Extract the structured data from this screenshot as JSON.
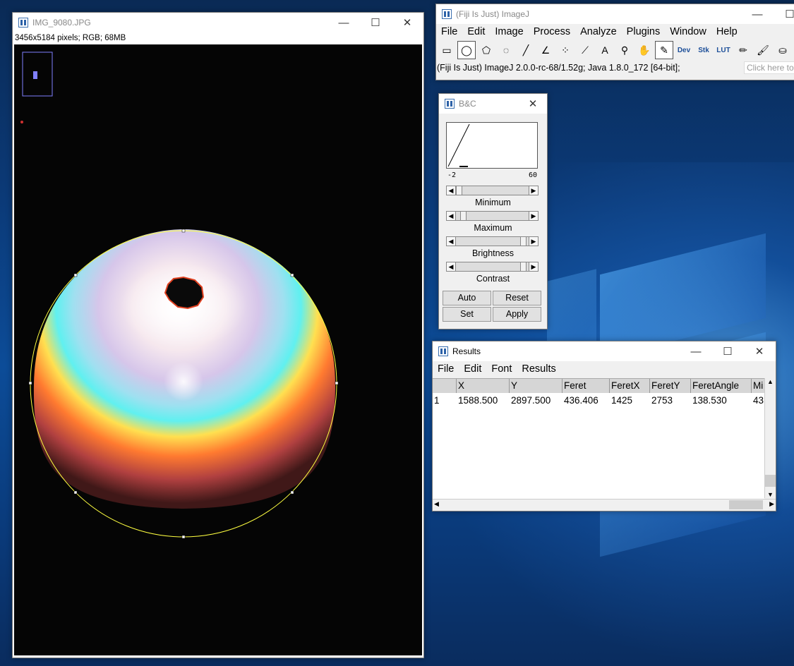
{
  "image_window": {
    "title": "IMG_9080.JPG",
    "info": "3456x5184 pixels; RGB; 68MB",
    "controls": {
      "minimize": "—",
      "maximize": "☐",
      "close": "✕"
    }
  },
  "imagej_window": {
    "title": "(Fiji Is Just) ImageJ",
    "menu": [
      "File",
      "Edit",
      "Image",
      "Process",
      "Analyze",
      "Plugins",
      "Window",
      "Help"
    ],
    "tools": [
      {
        "name": "rectangle-tool",
        "glyph": "▭"
      },
      {
        "name": "oval-tool",
        "glyph": "◯",
        "selected": true
      },
      {
        "name": "polygon-tool",
        "glyph": "⬠"
      },
      {
        "name": "freehand-tool",
        "glyph": "◌"
      },
      {
        "name": "line-tool",
        "glyph": "╱"
      },
      {
        "name": "angle-tool",
        "glyph": "∠"
      },
      {
        "name": "point-tool",
        "glyph": "⁘"
      },
      {
        "name": "wand-tool",
        "glyph": "⟋"
      },
      {
        "name": "text-tool",
        "glyph": "A"
      },
      {
        "name": "zoom-tool",
        "glyph": "⚲"
      },
      {
        "name": "hand-tool",
        "glyph": "✋"
      },
      {
        "name": "dropper-tool",
        "glyph": "✎"
      },
      {
        "name": "dev-tool",
        "glyph": "Dev"
      },
      {
        "name": "stk-tool",
        "glyph": "Stk"
      },
      {
        "name": "lut-tool",
        "glyph": "LUT"
      },
      {
        "name": "pencil-tool",
        "glyph": "✏"
      },
      {
        "name": "brush-tool",
        "glyph": "🖌"
      },
      {
        "name": "fill-tool",
        "glyph": "⛀"
      }
    ],
    "status": "(Fiji Is Just) ImageJ 2.0.0-rc-68/1.52g; Java 1.8.0_172 [64-bit];",
    "search_hint": "Click here to s"
  },
  "bc_window": {
    "title": "B&C",
    "hist_min": "-2",
    "hist_max": "60",
    "sliders": [
      {
        "label": "Minimum",
        "position": 0.0
      },
      {
        "label": "Maximum",
        "position": 0.0
      },
      {
        "label": "Brightness",
        "position": 0.9
      },
      {
        "label": "Contrast",
        "position": 0.9
      }
    ],
    "buttons": [
      "Auto",
      "Reset",
      "Set",
      "Apply"
    ]
  },
  "results_window": {
    "title": "Results",
    "menu": [
      "File",
      "Edit",
      "Font",
      "Results"
    ],
    "columns": [
      "",
      "X",
      "Y",
      "Feret",
      "FeretX",
      "FeretY",
      "FeretAngle",
      "Mi"
    ],
    "rows": [
      [
        "1",
        "1588.500",
        "2897.500",
        "436.406",
        "1425",
        "2753",
        "138.530",
        "43"
      ]
    ]
  }
}
